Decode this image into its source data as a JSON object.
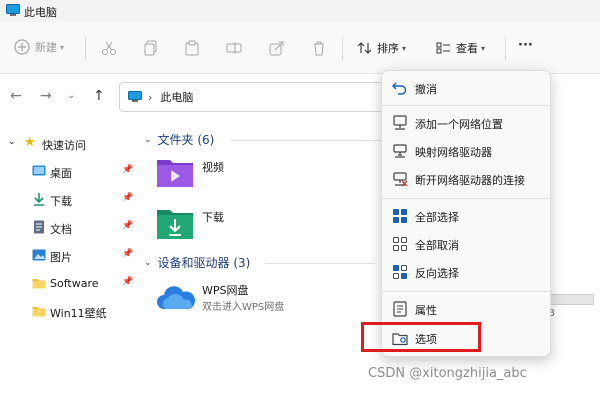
{
  "window": {
    "title": "此电脑"
  },
  "toolbar": {
    "new_label": "新建",
    "sort_label": "排序",
    "view_label": "查看",
    "more_label": "···"
  },
  "address": {
    "crumb_sep": "›",
    "location": "此电脑"
  },
  "sidebar": {
    "quick_access": "快速访问",
    "items": [
      {
        "label": "桌面",
        "icon": "desktop-icon",
        "pinned": true
      },
      {
        "label": "下载",
        "icon": "download-icon",
        "pinned": true
      },
      {
        "label": "文档",
        "icon": "document-icon",
        "pinned": true
      },
      {
        "label": "图片",
        "icon": "picture-icon",
        "pinned": true
      },
      {
        "label": "Software",
        "icon": "folder-icon",
        "pinned": true
      },
      {
        "label": "Win11壁纸",
        "icon": "folder-icon",
        "pinned": false
      }
    ]
  },
  "content": {
    "folders_header": "文件夹 (6)",
    "folders": [
      {
        "label": "视频",
        "icon": "video-folder-icon"
      },
      {
        "label": "下载",
        "icon": "download-folder-icon"
      }
    ],
    "drives_header": "设备和驱动器 (3)",
    "wps": {
      "name": "WPS网盘",
      "desc": "双击进入WPS网盘"
    },
    "partial_text": "B"
  },
  "context_menu": {
    "items": [
      {
        "label": "撤消",
        "icon": "undo-icon"
      },
      {
        "label": "添加一个网络位置",
        "icon": "add-network-location-icon"
      },
      {
        "label": "映射网络驱动器",
        "icon": "map-network-drive-icon"
      },
      {
        "label": "断开网络驱动器的连接",
        "icon": "disconnect-network-drive-icon"
      },
      {
        "label": "全部选择",
        "icon": "select-all-icon"
      },
      {
        "label": "全部取消",
        "icon": "select-none-icon"
      },
      {
        "label": "反向选择",
        "icon": "invert-selection-icon"
      },
      {
        "label": "属性",
        "icon": "properties-icon"
      },
      {
        "label": "选项",
        "icon": "options-icon"
      }
    ]
  },
  "watermark": "CSDN @xitongzhijia_abc",
  "colors": {
    "accent": "#0067c0",
    "highlight": "#e11b22",
    "folder": "#f0c040"
  }
}
